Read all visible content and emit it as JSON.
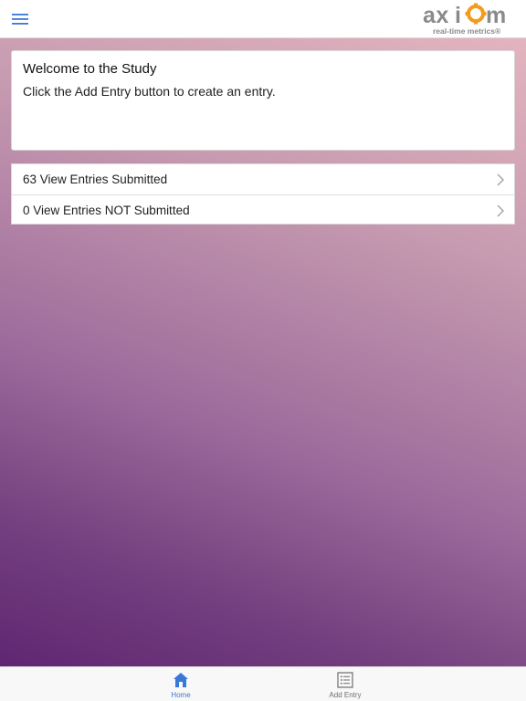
{
  "header": {
    "menu_icon": "hamburger-icon",
    "logo": {
      "wordmark": "axiom",
      "tagline": "real-time metrics®",
      "colors": {
        "text": "#8a8a8a",
        "gear": "#f29b1d",
        "tagline": "#8a8a8a"
      }
    }
  },
  "welcome_card": {
    "title": "Welcome to the Study",
    "text": "Click the Add Entry button to create an entry."
  },
  "entries_list": {
    "items": [
      {
        "label": "63 View Entries Submitted",
        "icon": "chevron-right-icon"
      },
      {
        "label": "0 View Entries NOT Submitted",
        "icon": "chevron-right-icon"
      }
    ]
  },
  "tabbar": {
    "tabs": [
      {
        "label": "Home",
        "icon": "home-icon",
        "active": true
      },
      {
        "label": "Add Entry",
        "icon": "list-icon",
        "active": false
      }
    ]
  },
  "colors": {
    "accent": "#3a78d8",
    "gradient_top": "#e3b4bf",
    "gradient_bottom": "#5f2672"
  }
}
